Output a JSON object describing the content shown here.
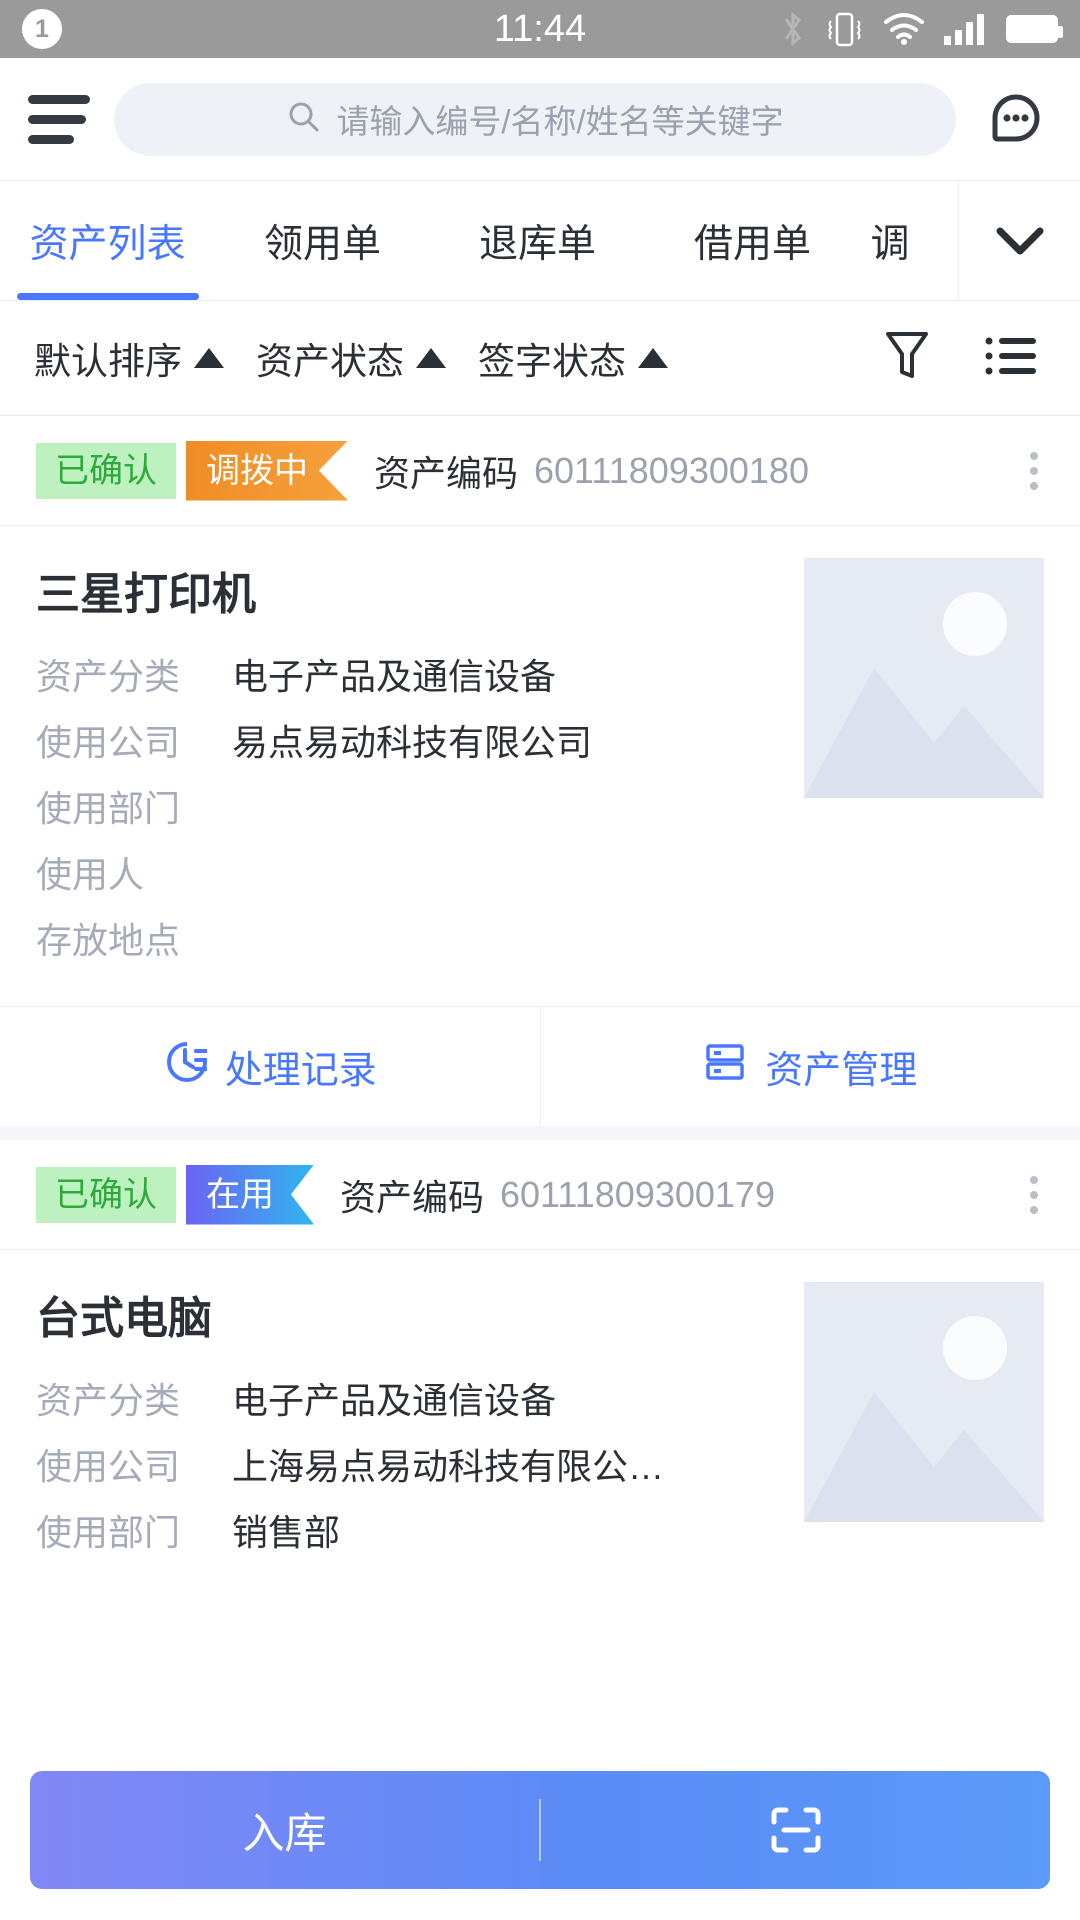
{
  "statusbar": {
    "notification_count": "1",
    "time": "11:44",
    "icons": [
      "bluetooth-icon",
      "vibrate-icon",
      "wifi-icon",
      "cellular-signal-icon",
      "battery-icon"
    ]
  },
  "topbar": {
    "menu_icon": "hamburger-menu-icon",
    "search": {
      "placeholder": "请输入编号/名称/姓名等关键字",
      "value": "",
      "icon": "search-icon"
    },
    "chat_icon": "chat-bubble-icon"
  },
  "tabs": {
    "items": [
      {
        "label": "资产列表",
        "active": true
      },
      {
        "label": "领用单",
        "active": false
      },
      {
        "label": "退库单",
        "active": false
      },
      {
        "label": "借用单",
        "active": false
      },
      {
        "label": "调",
        "active": false
      }
    ],
    "expand_icon": "chevron-down-icon"
  },
  "filterbar": {
    "items": [
      {
        "label": "默认排序",
        "icon": "caret-up-icon"
      },
      {
        "label": "资产状态",
        "icon": "caret-up-icon"
      },
      {
        "label": "签字状态",
        "icon": "caret-up-icon"
      }
    ],
    "funnel_icon": "filter-funnel-icon",
    "list_icon": "list-view-icon"
  },
  "cards": [
    {
      "status_badge": "已确认",
      "state_badge": "调拨中",
      "state_badge_style": "orange",
      "code_label": "资产编码",
      "code_value": "60111809300180",
      "menu_icon": "kebab-menu-icon",
      "title": "三星打印机",
      "fields": [
        {
          "label": "资产分类",
          "value": "电子产品及通信设备"
        },
        {
          "label": "使用公司",
          "value": "易点易动科技有限公司"
        },
        {
          "label": "使用部门",
          "value": ""
        },
        {
          "label": "使用人",
          "value": ""
        },
        {
          "label": "存放地点",
          "value": ""
        }
      ],
      "thumbnail": "image-placeholder",
      "actions": [
        {
          "label": "处理记录",
          "icon": "history-clock-icon"
        },
        {
          "label": "资产管理",
          "icon": "server-rack-icon"
        }
      ]
    },
    {
      "status_badge": "已确认",
      "state_badge": "在用",
      "state_badge_style": "blue",
      "code_label": "资产编码",
      "code_value": "60111809300179",
      "menu_icon": "kebab-menu-icon",
      "title": "台式电脑",
      "fields": [
        {
          "label": "资产分类",
          "value": "电子产品及通信设备"
        },
        {
          "label": "使用公司",
          "value": "上海易点易动科技有限公…"
        },
        {
          "label": "使用部门",
          "value": "销售部"
        }
      ],
      "thumbnail": "image-placeholder",
      "actions": []
    }
  ],
  "bottombar": {
    "primary_label": "入库",
    "scan_icon": "scan-barcode-icon"
  },
  "colors": {
    "accent": "#4878ff",
    "status_green_bg": "#bdf2c0",
    "status_green_text": "#2fa93c",
    "ribbon_orange": "#f08c26",
    "ribbon_blue": "#6c63f5",
    "muted_text": "#a5abb8",
    "statusbar_bg": "#9a9a9a",
    "page_bg": "#f4f6f9"
  }
}
